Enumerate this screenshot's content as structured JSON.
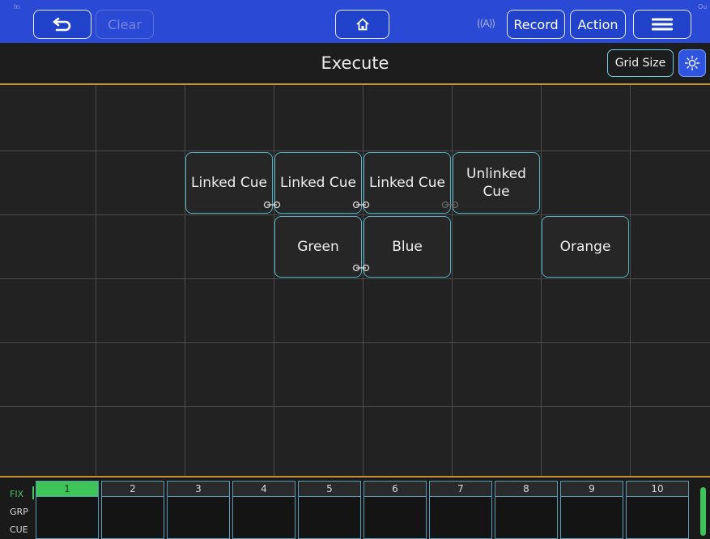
{
  "toolbar": {
    "left_tiny": "In",
    "right_tiny": "Ou",
    "clear_label": "Clear",
    "record_label": "Record",
    "action_label": "Action",
    "icons": {
      "undo": "undo-arrow-icon",
      "home": "home-icon",
      "radio": "wireless-icon",
      "menu": "hamburger-menu-icon"
    },
    "radio_glyph": "((A))"
  },
  "title": {
    "text": "Execute",
    "grid_size_label": "Grid Size",
    "light_icon": "lightbulb-icon"
  },
  "cues": [
    {
      "label": "Linked Cue"
    },
    {
      "label": "Linked Cue"
    },
    {
      "label": "Linked Cue"
    },
    {
      "label": "Unlinked Cue"
    },
    {
      "label": "Green"
    },
    {
      "label": "Blue"
    },
    {
      "label": "Orange"
    }
  ],
  "bottom": {
    "modes": [
      "FIX",
      "GRP",
      "CUE"
    ],
    "channels": [
      "1",
      "2",
      "3",
      "4",
      "5",
      "6",
      "7",
      "8",
      "9",
      "10"
    ],
    "active_channel": "1"
  },
  "colors": {
    "toolbar": "#2a49d4",
    "accent_orange": "#c7922e",
    "cue_border": "#54b3c9",
    "active_green": "#3fc458"
  }
}
